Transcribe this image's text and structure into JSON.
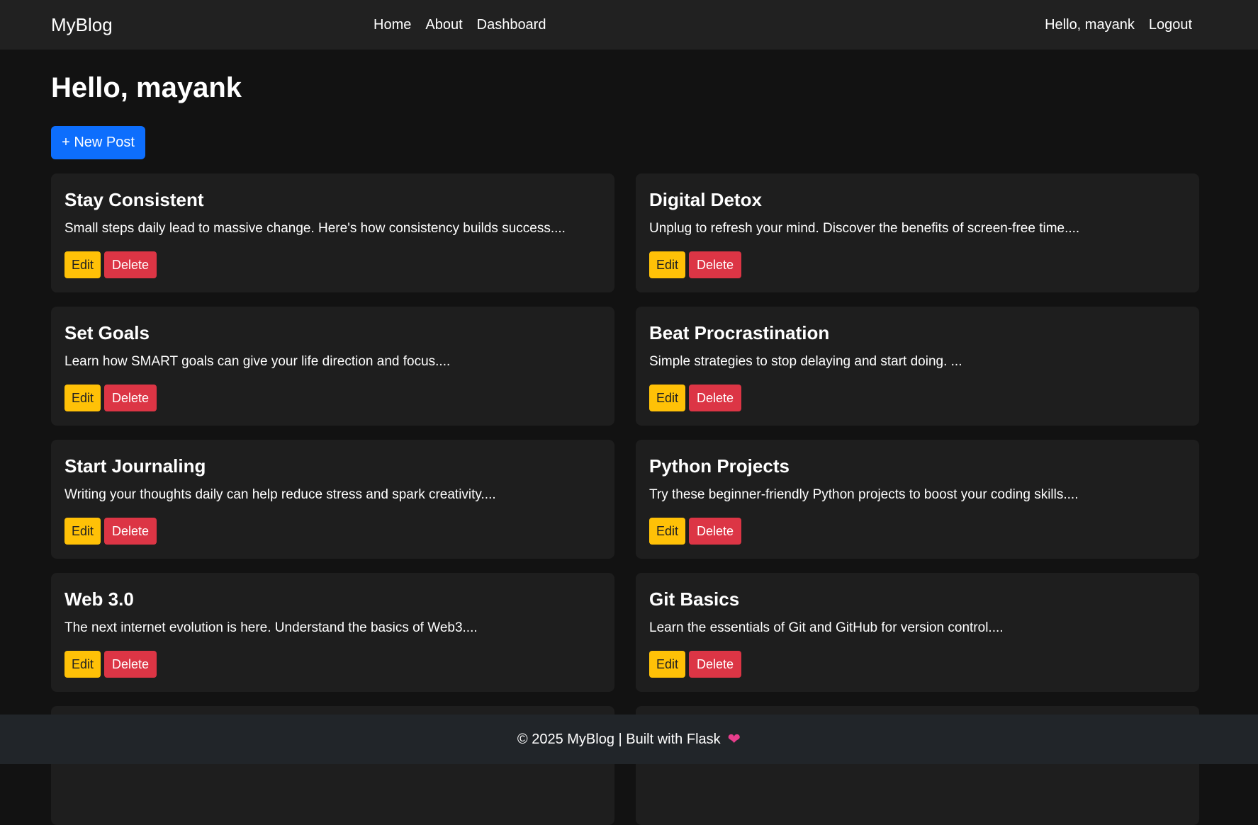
{
  "nav": {
    "brand": "MyBlog",
    "links": [
      "Home",
      "About",
      "Dashboard"
    ],
    "user_greeting": "Hello, mayank",
    "logout": "Logout"
  },
  "page": {
    "heading": "Hello, mayank",
    "new_post_label": "+ New Post"
  },
  "posts": [
    {
      "title": "Stay Consistent",
      "excerpt": "Small steps daily lead to massive change. Here's how consistency builds success....",
      "edit": "Edit",
      "delete": "Delete"
    },
    {
      "title": "Digital Detox",
      "excerpt": "Unplug to refresh your mind. Discover the benefits of screen-free time....",
      "edit": "Edit",
      "delete": "Delete"
    },
    {
      "title": "Set Goals",
      "excerpt": "Learn how SMART goals can give your life direction and focus....",
      "edit": "Edit",
      "delete": "Delete"
    },
    {
      "title": "Beat Procrastination",
      "excerpt": "Simple strategies to stop delaying and start doing. ...",
      "edit": "Edit",
      "delete": "Delete"
    },
    {
      "title": "Start Journaling",
      "excerpt": "Writing your thoughts daily can help reduce stress and spark creativity....",
      "edit": "Edit",
      "delete": "Delete"
    },
    {
      "title": "Python Projects",
      "excerpt": "Try these beginner-friendly Python projects to boost your coding skills....",
      "edit": "Edit",
      "delete": "Delete"
    },
    {
      "title": "Web 3.0",
      "excerpt": "The next internet evolution is here. Understand the basics of Web3....",
      "edit": "Edit",
      "delete": "Delete"
    },
    {
      "title": "Git Basics",
      "excerpt": "Learn the essentials of Git and GitHub for version control....",
      "edit": "Edit",
      "delete": "Delete"
    },
    {
      "title": "",
      "excerpt": "",
      "edit": "",
      "delete": ""
    },
    {
      "title": "",
      "excerpt": "",
      "edit": "",
      "delete": ""
    }
  ],
  "footer": {
    "text": "© 2025 MyBlog | Built with Flask",
    "icon": "heart-icon"
  },
  "colors": {
    "primary": "#0d6efd",
    "warning": "#ffc107",
    "danger": "#dc3545",
    "background": "#121212",
    "card": "#1e1e1e",
    "heart": "#e83e8c"
  }
}
